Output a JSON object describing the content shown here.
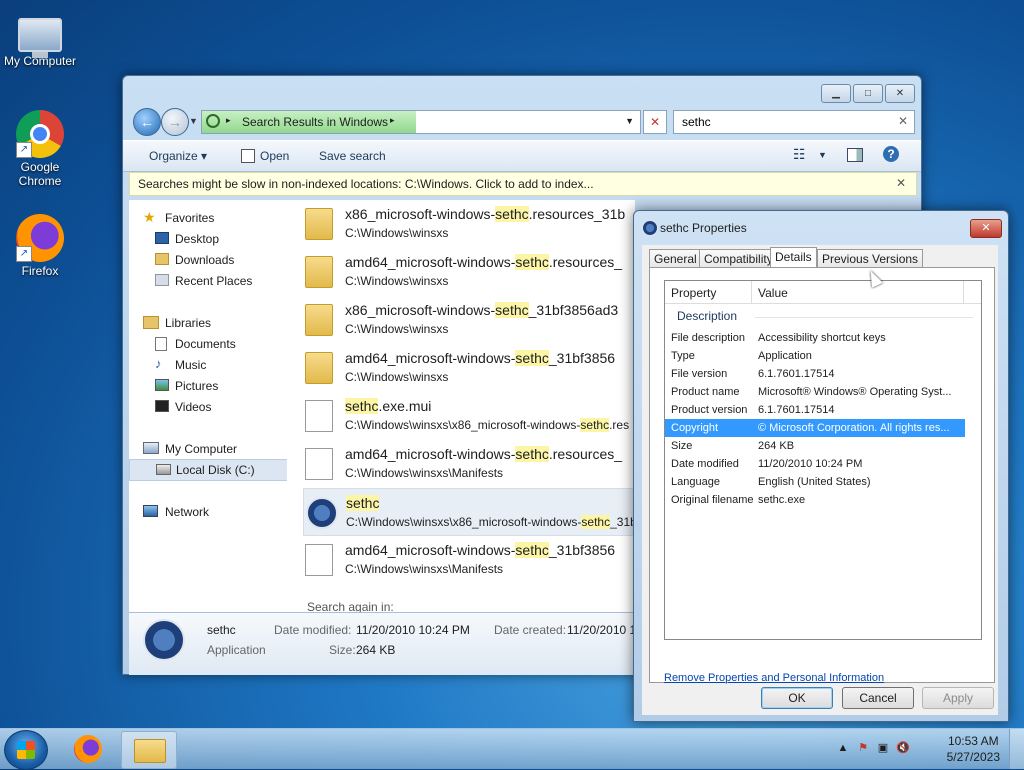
{
  "desktop": {
    "icons": [
      {
        "label": "My Computer",
        "icon": "computer-icon"
      },
      {
        "label": "Google Chrome",
        "icon": "chrome-icon"
      },
      {
        "label": "Firefox",
        "icon": "firefox-icon"
      }
    ]
  },
  "explorer": {
    "address": {
      "text": "Search Results in Windows"
    },
    "search": {
      "value": "sethc"
    },
    "toolbar": {
      "organize": "Organize ▾",
      "open": "Open",
      "save_search": "Save search"
    },
    "infobar": "Searches might be slow in non-indexed locations: C:\\Windows. Click to add to index...",
    "nav": {
      "favorites": "Favorites",
      "desktop": "Desktop",
      "downloads": "Downloads",
      "recent_places": "Recent Places",
      "libraries": "Libraries",
      "documents": "Documents",
      "music": "Music",
      "pictures": "Pictures",
      "videos": "Videos",
      "my_computer": "My Computer",
      "local_disk": "Local Disk (C:)",
      "network": "Network"
    },
    "results": [
      {
        "pre": "x86_microsoft-windows-",
        "hl": "sethc",
        "post": ".resources_31b",
        "path_pre": "C:\\Windows\\winsxs",
        "path_hl": "",
        "path_post": "",
        "type": "folder"
      },
      {
        "pre": "amd64_microsoft-windows-",
        "hl": "sethc",
        "post": ".resources_",
        "path_pre": "C:\\Windows\\winsxs",
        "path_hl": "",
        "path_post": "",
        "type": "folder"
      },
      {
        "pre": "x86_microsoft-windows-",
        "hl": "sethc",
        "post": "_31bf3856ad3",
        "path_pre": "C:\\Windows\\winsxs",
        "path_hl": "",
        "path_post": "",
        "type": "folder"
      },
      {
        "pre": "amd64_microsoft-windows-",
        "hl": "sethc",
        "post": "_31bf3856",
        "path_pre": "C:\\Windows\\winsxs",
        "path_hl": "",
        "path_post": "",
        "type": "folder"
      },
      {
        "pre": "",
        "hl": "sethc",
        "post": ".exe.mui",
        "path_pre": "C:\\Windows\\winsxs\\x86_microsoft-windows-",
        "path_hl": "sethc",
        "path_post": ".res",
        "type": "file"
      },
      {
        "pre": "amd64_microsoft-windows-",
        "hl": "sethc",
        "post": ".resources_",
        "path_pre": "C:\\Windows\\winsxs\\Manifests",
        "path_hl": "",
        "path_post": "",
        "type": "file"
      },
      {
        "pre": "",
        "hl": "sethc",
        "post": "",
        "path_pre": "C:\\Windows\\winsxs\\x86_microsoft-windows-",
        "path_hl": "sethc",
        "path_post": "_31b",
        "type": "exe"
      },
      {
        "pre": "amd64_microsoft-windows-",
        "hl": "sethc",
        "post": "_31bf3856",
        "path_pre": "C:\\Windows\\winsxs\\Manifests",
        "path_hl": "",
        "path_post": "",
        "type": "file"
      }
    ],
    "search_again": "Search again in:",
    "details": {
      "name": "sethc",
      "type": "Application",
      "date_modified_label": "Date modified:",
      "date_modified": "11/20/2010 10:24 PM",
      "size_label": "Size:",
      "size": "264 KB",
      "date_created_label": "Date created:",
      "date_created": "11/20/2010 1"
    }
  },
  "properties": {
    "title": "sethc Properties",
    "tabs": [
      "General",
      "Compatibility",
      "Details",
      "Previous Versions"
    ],
    "active_tab": "Details",
    "headers": {
      "property": "Property",
      "value": "Value"
    },
    "group": "Description",
    "rows": [
      {
        "k": "File description",
        "v": "Accessibility shortcut keys"
      },
      {
        "k": "Type",
        "v": "Application"
      },
      {
        "k": "File version",
        "v": "6.1.7601.17514"
      },
      {
        "k": "Product name",
        "v": "Microsoft® Windows® Operating Syst..."
      },
      {
        "k": "Product version",
        "v": "6.1.7601.17514"
      },
      {
        "k": "Copyright",
        "v": "© Microsoft Corporation. All rights res..."
      },
      {
        "k": "Size",
        "v": "264 KB"
      },
      {
        "k": "Date modified",
        "v": "11/20/2010 10:24 PM"
      },
      {
        "k": "Language",
        "v": "English (United States)"
      },
      {
        "k": "Original filename",
        "v": "sethc.exe"
      }
    ],
    "selected_row": "Copyright",
    "remove_link": "Remove Properties and Personal Information",
    "buttons": {
      "ok": "OK",
      "cancel": "Cancel",
      "apply": "Apply"
    }
  },
  "taskbar": {
    "time": "10:53 AM",
    "date": "5/27/2023"
  }
}
